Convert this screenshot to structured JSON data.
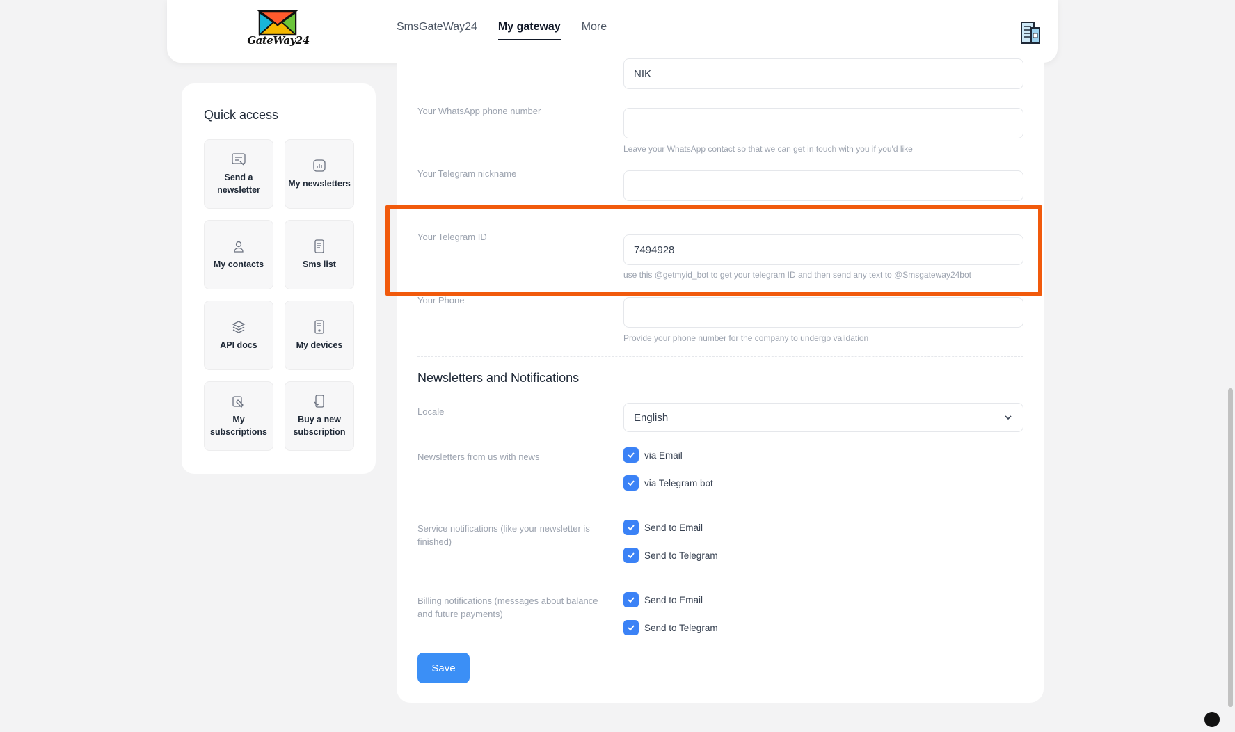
{
  "header": {
    "logo_text": "GateWay24",
    "nav": [
      {
        "label": "SmsGateWay24",
        "active": false
      },
      {
        "label": "My gateway",
        "active": true
      },
      {
        "label": "More",
        "active": false
      }
    ]
  },
  "sidebar": {
    "title": "Quick access",
    "tiles": [
      {
        "label": "Send a newsletter",
        "icon": "newsletter-send-icon"
      },
      {
        "label": "My newsletters",
        "icon": "chart-icon"
      },
      {
        "label": "My contacts",
        "icon": "user-icon"
      },
      {
        "label": "Sms list",
        "icon": "sms-icon"
      },
      {
        "label": "API docs",
        "icon": "layers-icon"
      },
      {
        "label": "My devices",
        "icon": "device-icon"
      },
      {
        "label": "My subscriptions",
        "icon": "subscriptions-icon"
      },
      {
        "label": "Buy a new subscription",
        "icon": "buy-subscription-icon"
      }
    ]
  },
  "form": {
    "name_value": "NIK",
    "whatsapp": {
      "label": "Your WhatsApp phone number",
      "value": "",
      "hint": "Leave your WhatsApp contact so that we can get in touch with you if you'd like"
    },
    "telegram_nick": {
      "label": "Your Telegram nickname",
      "value": ""
    },
    "telegram_id": {
      "label": "Your Telegram ID",
      "value": "7494928",
      "hint": "use this @getmyid_bot to get your telegram ID and then send any text to @Smsgateway24bot"
    },
    "phone": {
      "label": "Your Phone",
      "value": "",
      "hint": "Provide your phone number for the company to undergo validation"
    },
    "section_title": "Newsletters and Notifications",
    "locale": {
      "label": "Locale",
      "value": "English"
    },
    "newsletters": {
      "label": "Newsletters from us with news",
      "options": [
        "via Email",
        "via Telegram bot"
      ]
    },
    "service": {
      "label": "Service notifications (like your newsletter is finished)",
      "options": [
        "Send to Email",
        "Send to Telegram"
      ]
    },
    "billing": {
      "label": "Billing notifications (messages about balance and future payments)",
      "options": [
        "Send to Email",
        "Send to Telegram"
      ]
    },
    "save_label": "Save"
  },
  "colors": {
    "accent": "#3b82f6",
    "highlight": "#f15a0c"
  }
}
